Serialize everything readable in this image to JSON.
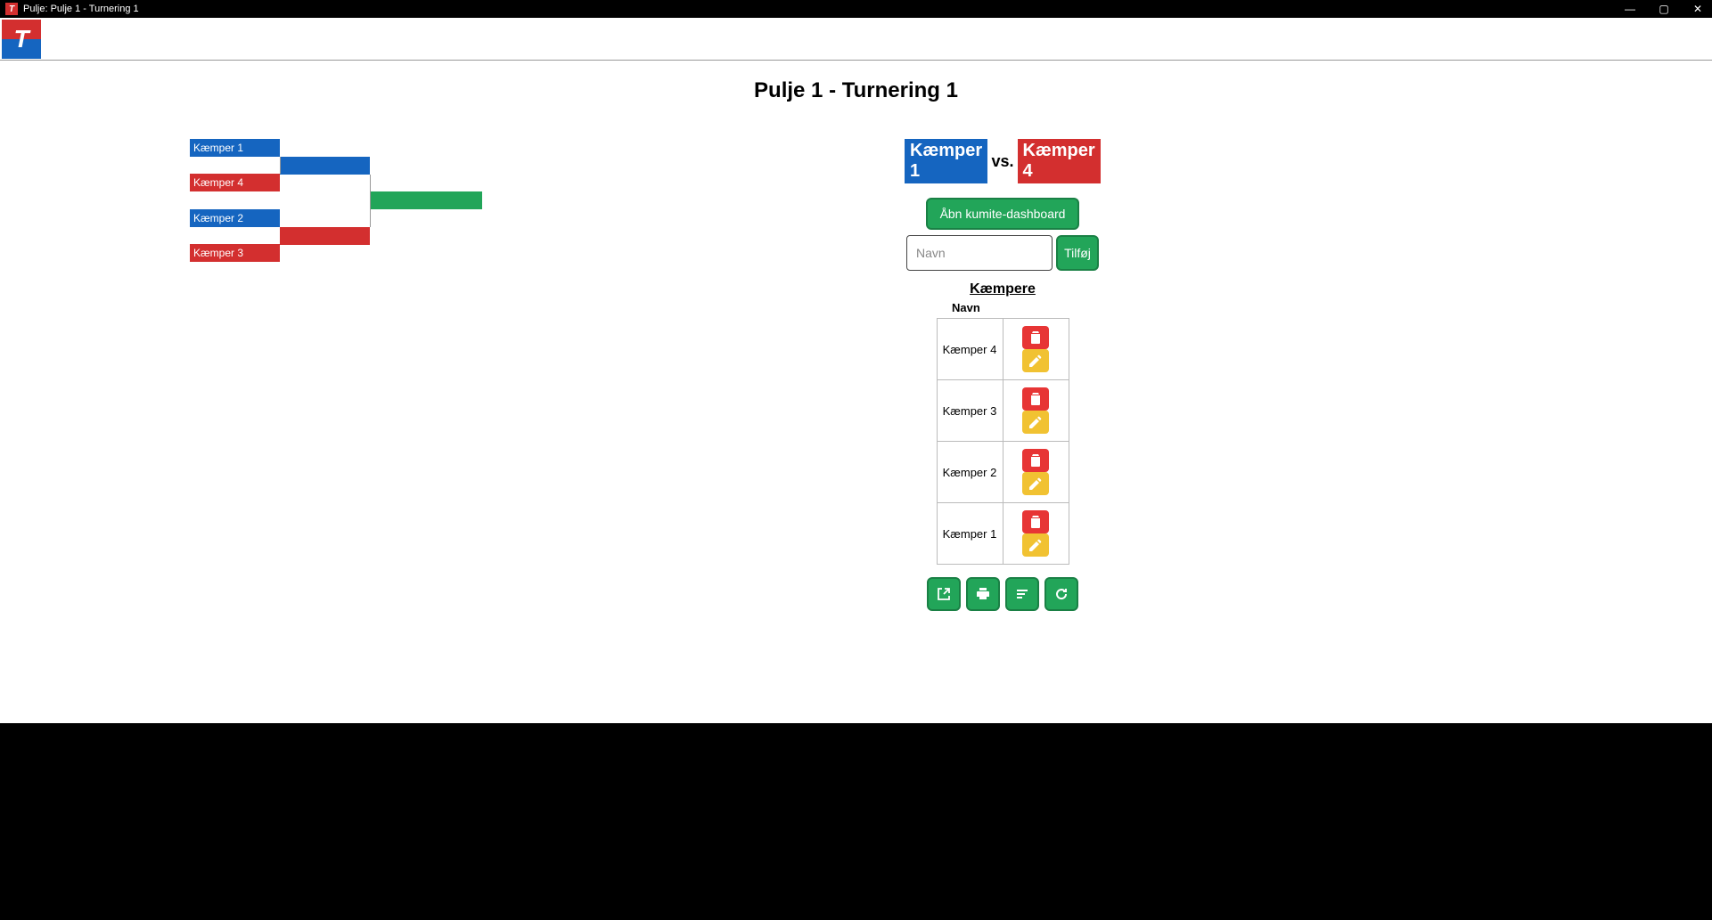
{
  "window": {
    "title": "Pulje: Pulje 1 - Turnering 1"
  },
  "page": {
    "title": "Pulje 1 - Turnering 1"
  },
  "bracket": {
    "round1": [
      {
        "name": "Kæmper 1",
        "color": "blue"
      },
      {
        "name": "Kæmper 4",
        "color": "red"
      },
      {
        "name": "Kæmper 2",
        "color": "blue"
      },
      {
        "name": "Kæmper 3",
        "color": "red"
      }
    ],
    "round2": [
      {
        "name": "",
        "color": "blue"
      },
      {
        "name": "",
        "color": "red"
      }
    ],
    "final": {
      "name": "",
      "color": "green"
    }
  },
  "sidebar": {
    "match": {
      "blue_fighter": "Kæmper 1",
      "vs_label": "vs.",
      "red_fighter": "Kæmper 4"
    },
    "open_dashboard_label": "Åbn kumite-dashboard",
    "name_input_placeholder": "Navn",
    "add_label": "Tilføj",
    "fighters_heading": "Kæmpere",
    "name_column": "Navn",
    "fighters": [
      {
        "name": "Kæmper 4"
      },
      {
        "name": "Kæmper 3"
      },
      {
        "name": "Kæmper 2"
      },
      {
        "name": "Kæmper 1"
      }
    ]
  }
}
